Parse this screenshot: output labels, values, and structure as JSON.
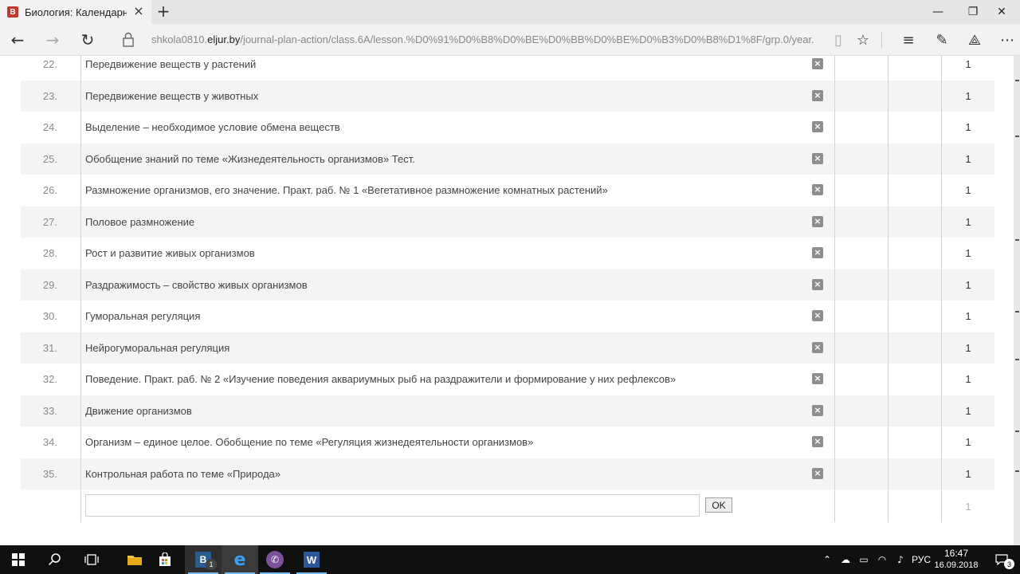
{
  "browser": {
    "tab_title": "Биология: Календарно",
    "tab_favicon_letter": "В",
    "url_prefix": "shkola0810.",
    "url_host": "eljur.by",
    "url_path": "/journal-plan-action/class.6A/lesson.%D0%91%D0%B8%D0%BE%D0%BB%D0%BE%D0%B3%D0%B8%D1%8F/grp.0/year."
  },
  "lessons": [
    {
      "num": "22.",
      "title": "Передвижение веществ у растений",
      "hours": "1"
    },
    {
      "num": "23.",
      "title": "Передвижение веществ у животных",
      "hours": "1"
    },
    {
      "num": "24.",
      "title": "Выделение – необходимое условие обмена веществ",
      "hours": "1"
    },
    {
      "num": "25.",
      "title": "Обобщение знаний по теме «Жизнедеятельность организмов» Тест.",
      "hours": "1"
    },
    {
      "num": "26.",
      "title": "Размножение организмов, его значение. Практ. раб. № 1 «Вегетативное размножение комнатных растений»",
      "hours": "1"
    },
    {
      "num": "27.",
      "title": "Половое размножение",
      "hours": "1"
    },
    {
      "num": "28.",
      "title": "Рост и развитие живых организмов",
      "hours": "1"
    },
    {
      "num": "29.",
      "title": "Раздражимость – свойство живых организмов",
      "hours": "1"
    },
    {
      "num": "30.",
      "title": "Гуморальная регуляция",
      "hours": "1"
    },
    {
      "num": "31.",
      "title": "Нейрогуморальная регуляция",
      "hours": "1"
    },
    {
      "num": "32.",
      "title": "Поведение. Практ. раб. № 2 «Изучение поведения аквариумных рыб на раздражители и формирование у них рефлексов»",
      "hours": "1"
    },
    {
      "num": "33.",
      "title": "Движение организмов",
      "hours": "1"
    },
    {
      "num": "34.",
      "title": "Организм – единое целое. Обобщение по теме «Регуляция жизнедеятельности организмов»",
      "hours": "1"
    },
    {
      "num": "35.",
      "title": "Контрольная работа по теме «Природа»",
      "hours": "1"
    }
  ],
  "new_lesson": {
    "value": "",
    "ok_label": "OK",
    "hours": "1"
  },
  "taskbar": {
    "word_badge": "W",
    "b_label": "B",
    "b_badge": "1",
    "lang": "РУС",
    "time": "16:47",
    "date": "16.09.2018",
    "notif_count": "3"
  }
}
